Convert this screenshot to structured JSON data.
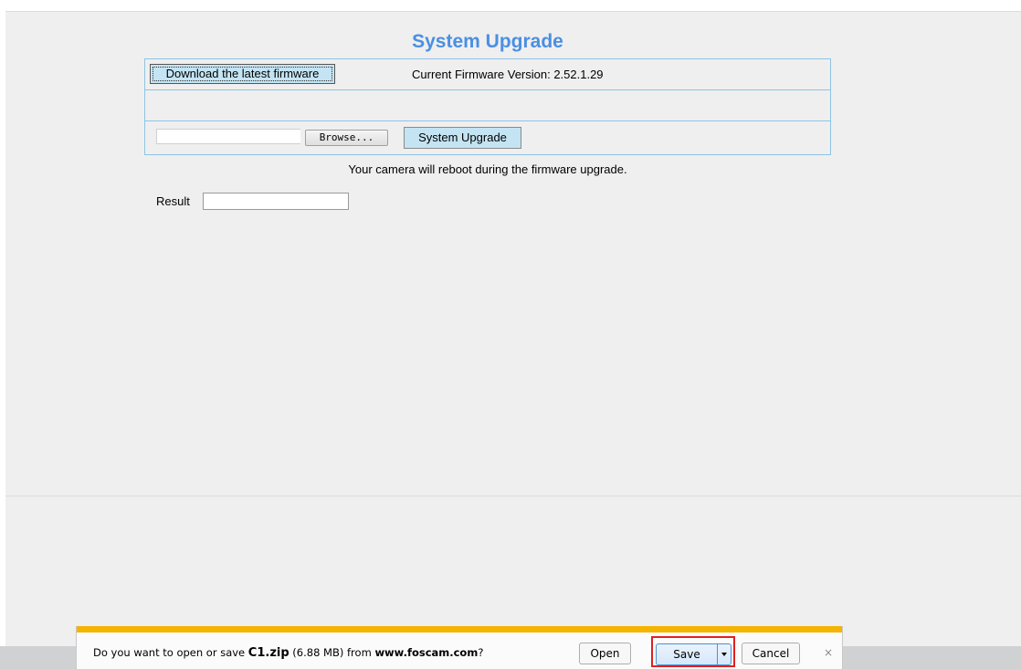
{
  "page": {
    "title": "System Upgrade",
    "download_button_label": "Download the latest firmware",
    "firmware_version_label": "Current Firmware Version: 2.52.1.29",
    "browse_button_label": "Browse...",
    "file_path_value": "",
    "upgrade_button_label": "System Upgrade",
    "result_label": "Result",
    "result_value": "",
    "notice": "Your camera will reboot during the firmware upgrade."
  },
  "download_bar": {
    "message_prefix": "Do you want to open or save ",
    "file_name": "C1.zip",
    "file_size": " (6.88 MB) from ",
    "source_site": "www.foscam.com",
    "message_suffix": "?",
    "open_label": "Open",
    "save_label": "Save",
    "cancel_label": "Cancel",
    "close_glyph": "×",
    "save_dropdown_icon": "chevron-down-icon"
  },
  "colors": {
    "title_blue": "#4a8fe3",
    "button_light_blue": "#c4e4f3",
    "table_border": "#8fc3e3",
    "notification_accent": "#f4b400",
    "highlight_red": "#e02020"
  }
}
